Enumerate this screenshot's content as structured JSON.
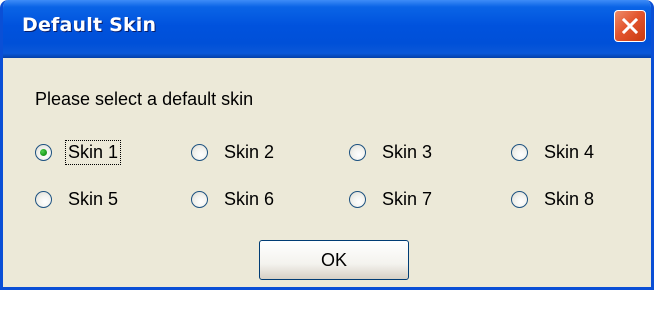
{
  "dialog": {
    "title": "Default Skin",
    "close_icon": "close-icon",
    "prompt": "Please select a default skin",
    "ok_label": "OK"
  },
  "skins": [
    {
      "label": "Skin 1",
      "selected": true
    },
    {
      "label": "Skin 2",
      "selected": false
    },
    {
      "label": "Skin 3",
      "selected": false
    },
    {
      "label": "Skin 4",
      "selected": false
    },
    {
      "label": "Skin 5",
      "selected": false
    },
    {
      "label": "Skin 6",
      "selected": false
    },
    {
      "label": "Skin 7",
      "selected": false
    },
    {
      "label": "Skin 8",
      "selected": false
    }
  ],
  "colors": {
    "titlebar": "#0052dd",
    "window_body": "#ece9d8",
    "close_button": "#e3552e",
    "radio_dot": "#21a121"
  }
}
